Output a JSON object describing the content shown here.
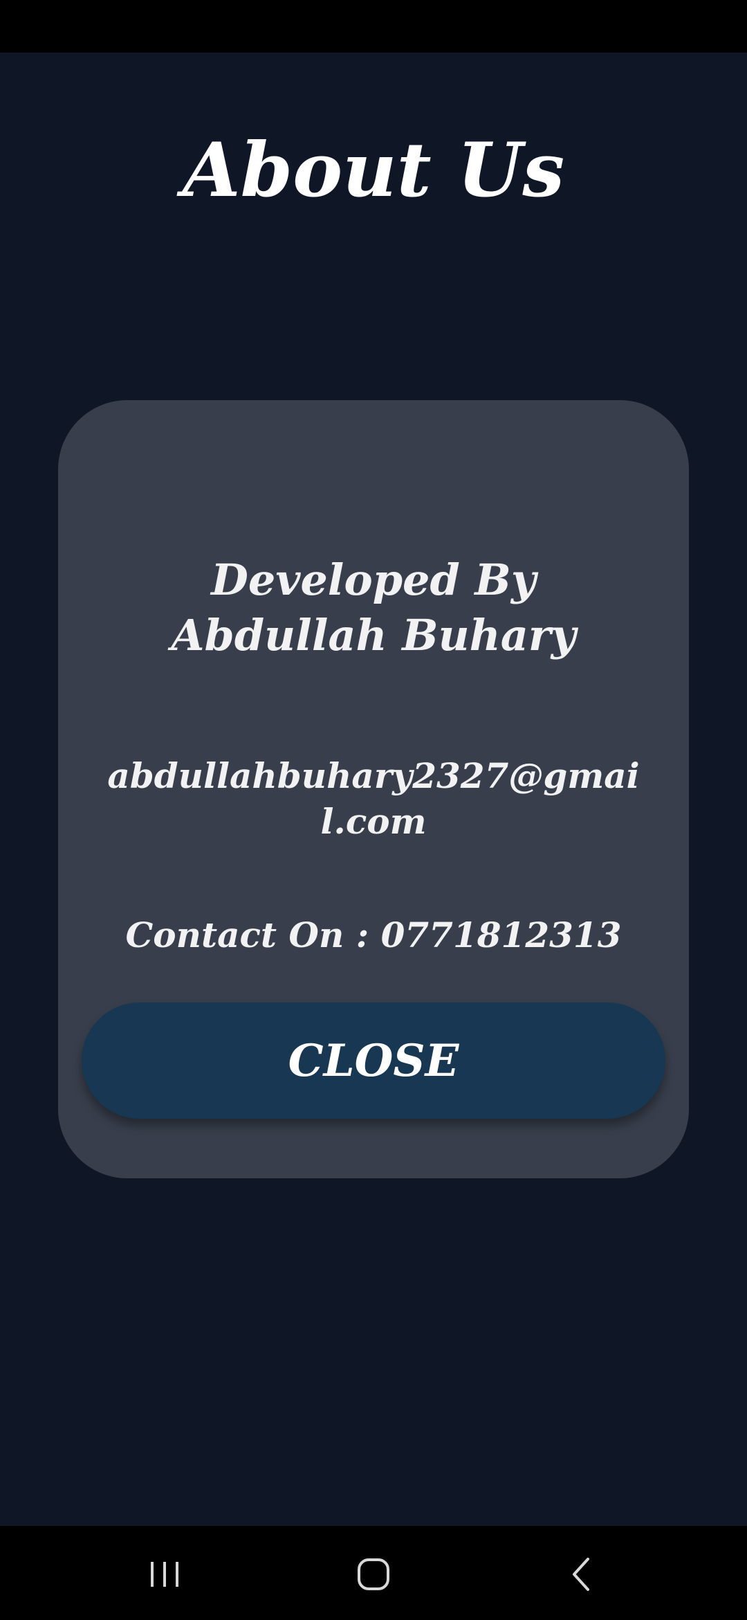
{
  "page": {
    "title": "About Us"
  },
  "card": {
    "developer": "Developed By Abdullah Buhary",
    "email": "abdullahbuhary2327@gmail.com",
    "contact": "Contact On : 0771812313",
    "close_label": "CLOSE"
  },
  "nav": {
    "recent_icon": "recent-apps-icon",
    "home_icon": "home-icon",
    "back_icon": "back-icon"
  },
  "colors": {
    "background": "#0f1727",
    "card": "#383e4b",
    "button": "#173752",
    "text": "#ffffff"
  }
}
